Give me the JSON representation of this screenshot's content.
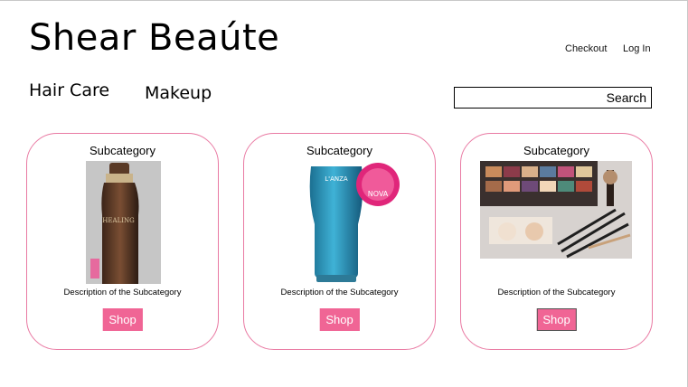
{
  "header": {
    "brand": "Shear Beaúte",
    "links": {
      "checkout": "Checkout",
      "login": "Log In"
    }
  },
  "nav": {
    "hair_care": "Hair Care",
    "makeup": "Makeup"
  },
  "search": {
    "label": "Search",
    "value": ""
  },
  "cards": [
    {
      "title": "Subcategory",
      "description": "Description of the Subcategory",
      "button": "Shop",
      "image": "hair-oil-bottle-photo"
    },
    {
      "title": "Subcategory",
      "description": "Description of the Subcategory",
      "button": "Shop",
      "image": "blue-conditioner-bottle-photo"
    },
    {
      "title": "Subcategory",
      "description": "Description of the Subcategory",
      "button": "Shop",
      "image": "makeup-palette-brushes-photo"
    }
  ],
  "colors": {
    "accent_pink": "#f06595",
    "card_border": "#e97aa3"
  }
}
